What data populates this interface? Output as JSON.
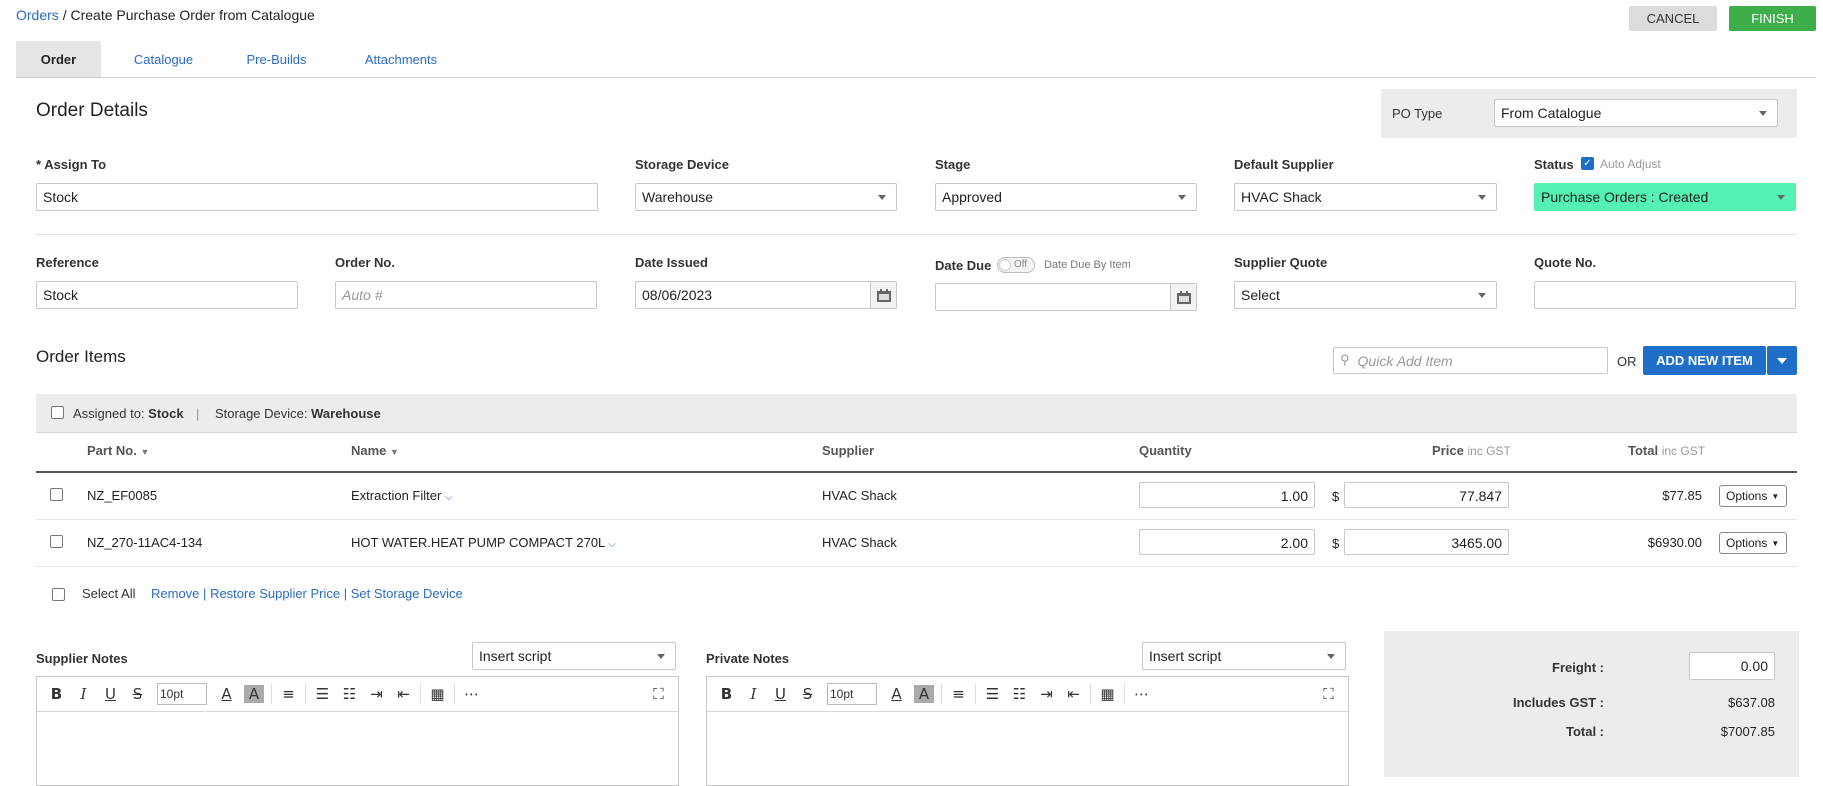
{
  "breadcrumb": {
    "root": "Orders",
    "separator": "/",
    "current": "Create Purchase Order from Catalogue"
  },
  "actions": {
    "cancel": "CANCEL",
    "finish": "FINISH"
  },
  "tabs": [
    "Order",
    "Catalogue",
    "Pre-Builds",
    "Attachments"
  ],
  "order_details": {
    "title": "Order Details",
    "po_type": {
      "label": "PO Type",
      "value": "From Catalogue"
    },
    "assign_to": {
      "label": "* Assign To",
      "value": "Stock"
    },
    "storage_device": {
      "label": "Storage Device",
      "value": "Warehouse"
    },
    "stage": {
      "label": "Stage",
      "value": "Approved"
    },
    "default_supplier": {
      "label": "Default Supplier",
      "value": "HVAC Shack"
    },
    "status": {
      "label": "Status",
      "auto_adjust": "Auto Adjust",
      "value": "Purchase Orders : Created"
    },
    "reference": {
      "label": "Reference",
      "value": "Stock"
    },
    "order_no": {
      "label": "Order No.",
      "placeholder": "Auto #"
    },
    "date_issued": {
      "label": "Date Issued",
      "value": "08/06/2023"
    },
    "date_due": {
      "label": "Date Due",
      "toggle": "Off",
      "by_item": "Date Due By Item",
      "value": ""
    },
    "supplier_quote": {
      "label": "Supplier Quote",
      "value": "Select"
    },
    "quote_no": {
      "label": "Quote No.",
      "value": ""
    }
  },
  "order_items": {
    "title": "Order Items",
    "quick_add_placeholder": "Quick Add Item",
    "or": "OR",
    "add_new": "ADD NEW ITEM",
    "group": {
      "assigned_label": "Assigned to:",
      "assigned_value": "Stock",
      "sep": "|",
      "storage_label": "Storage Device:",
      "storage_value": "Warehouse"
    },
    "columns": {
      "part_no": "Part No.",
      "name": "Name",
      "supplier": "Supplier",
      "quantity": "Quantity",
      "price": "Price",
      "price_sub": "inc GST",
      "total": "Total",
      "total_sub": "inc GST"
    },
    "rows": [
      {
        "part_no": "NZ_EF0085",
        "name": "Extraction Filter",
        "supplier": "HVAC Shack",
        "quantity": "1.00",
        "currency": "$",
        "price": "77.847",
        "total": "$77.85",
        "options": "Options"
      },
      {
        "part_no": "NZ_270-11AC4-134",
        "name": "HOT WATER.HEAT PUMP COMPACT 270L",
        "supplier": "HVAC Shack",
        "quantity": "2.00",
        "currency": "$",
        "price": "3465.00",
        "total": "$6930.00",
        "options": "Options"
      }
    ],
    "footer": {
      "select_all": "Select All",
      "remove": "Remove",
      "restore": "Restore Supplier Price",
      "set_storage": "Set Storage Device",
      "sep": "|"
    }
  },
  "notes": {
    "supplier": {
      "label": "Supplier Notes",
      "insert_script": "Insert script",
      "font_size": "10pt"
    },
    "private": {
      "label": "Private Notes",
      "insert_script": "Insert script",
      "font_size": "10pt"
    }
  },
  "totals": {
    "freight_label": "Freight :",
    "freight_value": "0.00",
    "gst_label": "Includes GST :",
    "gst_value": "$637.08",
    "total_label": "Total :",
    "total_value": "$7007.85"
  },
  "colors": {
    "finish": "#3dae49",
    "cancel": "#dcdcdc",
    "primary": "#1f6fc8",
    "status_bg": "#54f2b0",
    "link": "#2a6cc4"
  }
}
